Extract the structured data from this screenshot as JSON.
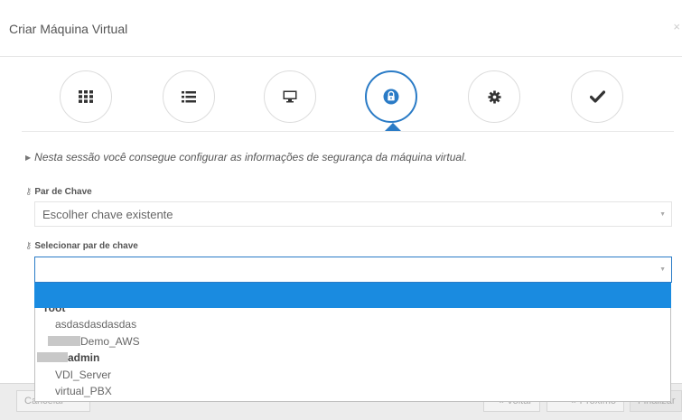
{
  "modal": {
    "title": "Criar Máquina Virtual",
    "close_label": "×"
  },
  "steps": [
    {
      "icon": "grid-icon"
    },
    {
      "icon": "list-icon"
    },
    {
      "icon": "monitor-icon"
    },
    {
      "icon": "lock-icon",
      "active": true
    },
    {
      "icon": "gear-icon"
    },
    {
      "icon": "check-icon"
    }
  ],
  "info_text": "Nesta sessão você consegue configurar as informações de segurança da máquina virtual.",
  "key_pair": {
    "label": "Par de Chave",
    "value": "Escolher chave existente"
  },
  "select_key_pair": {
    "label": "Selecionar par de chave",
    "value": ""
  },
  "dropdown": {
    "groups": [
      {
        "label": "root",
        "items": [
          "asdasdasdasdas",
          "Demo_AWS"
        ]
      },
      {
        "label": "admin",
        "items": [
          "VDI_Server",
          "virtual_PBX"
        ]
      }
    ]
  },
  "footer": {
    "cancel": "Cancelar",
    "back": "Voltar",
    "next": "Próximo",
    "finish": "Finalizar"
  },
  "colors": {
    "accent": "#2a7bc6",
    "dropdown_highlight": "#1a8be0"
  }
}
